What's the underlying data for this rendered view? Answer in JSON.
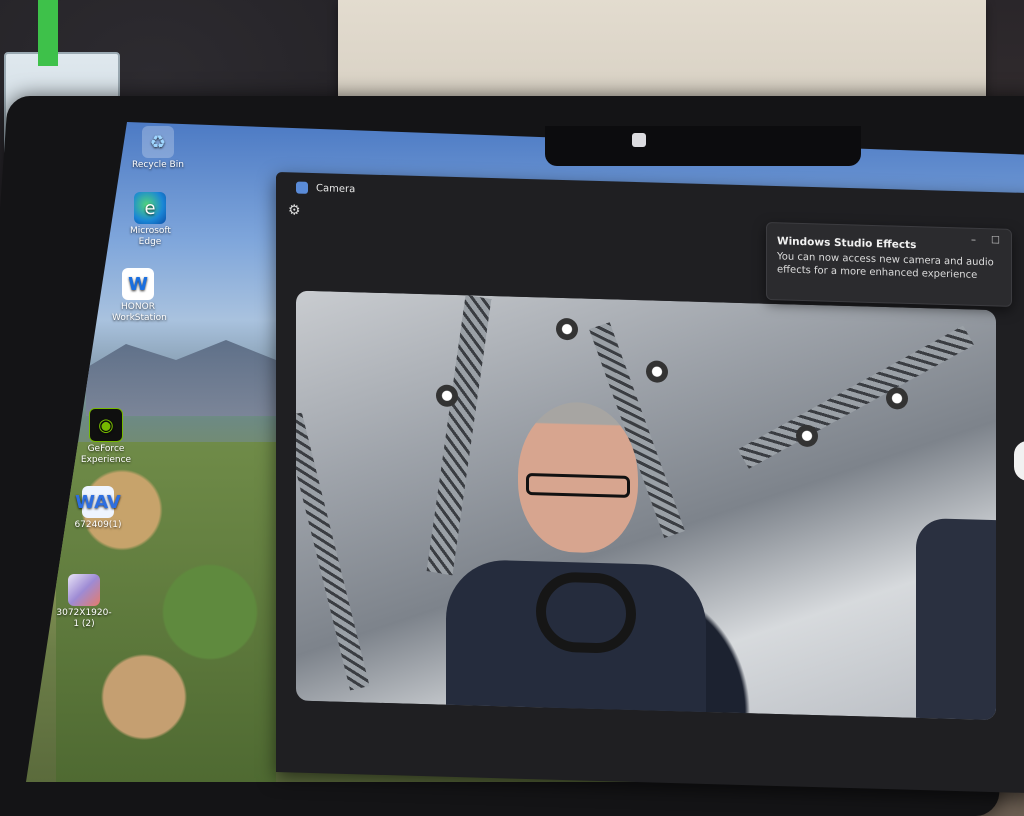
{
  "desktop": {
    "icons": [
      {
        "label": "Recycle Bin",
        "icon": "recycle-bin-icon",
        "glyph": "♻"
      },
      {
        "label": "Microsoft Edge",
        "icon": "edge-icon",
        "glyph": "e"
      },
      {
        "label": "HONOR WorkStation",
        "icon": "honor-workstation-icon",
        "glyph": "W"
      },
      {
        "label": "GeForce Experience",
        "icon": "nvidia-icon",
        "glyph": "◉"
      },
      {
        "label": "672409(1)",
        "icon": "wav-file-icon",
        "glyph": "WAV"
      },
      {
        "label": "3072X1920-1 (2)",
        "icon": "image-file-icon",
        "glyph": ""
      }
    ]
  },
  "camera_app": {
    "title": "Camera",
    "settings_glyph": "⚙"
  },
  "toast": {
    "title": "Windows Studio Effects",
    "body": "You can now access new camera and audio effects for a more enhanced experience",
    "minimize_glyph": "–",
    "maximize_glyph": "☐"
  }
}
